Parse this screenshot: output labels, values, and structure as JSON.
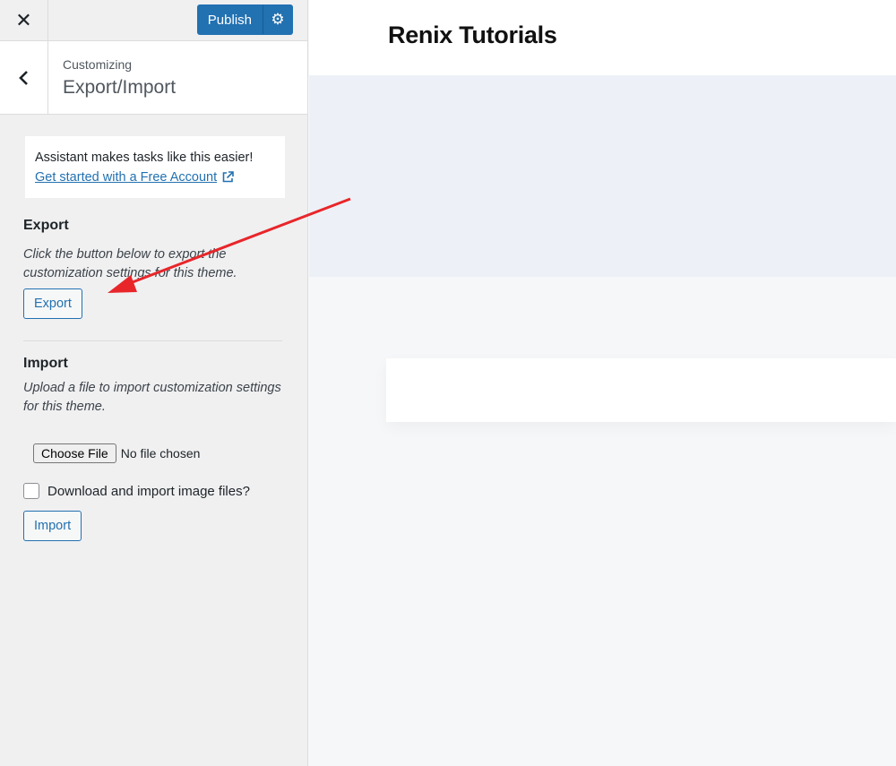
{
  "topbar": {
    "close_icon": "close-icon",
    "publish_label": "Publish",
    "gear_icon": "gear-icon"
  },
  "section": {
    "back_icon": "chevron-left-icon",
    "subtitle": "Customizing",
    "title": "Export/Import"
  },
  "notice": {
    "text": "Assistant makes tasks like this easier!",
    "link": "Get started with a Free Account",
    "link_icon": "external-link-icon"
  },
  "export": {
    "heading": "Export",
    "description": "Click the button below to export the customization settings for this theme.",
    "button": "Export"
  },
  "import": {
    "heading": "Import",
    "description": "Upload a file to import customization settings for this theme.",
    "choose_file": "Choose File",
    "file_status": "No file chosen",
    "checkbox_label": "Download and import image files?",
    "checkbox_checked": false,
    "button": "Import"
  },
  "preview": {
    "site_title": "Renix Tutorials"
  },
  "colors": {
    "accent": "#2271b1",
    "annotation_arrow": "#e8262a",
    "sidebar_bg": "#f0f0f1"
  }
}
